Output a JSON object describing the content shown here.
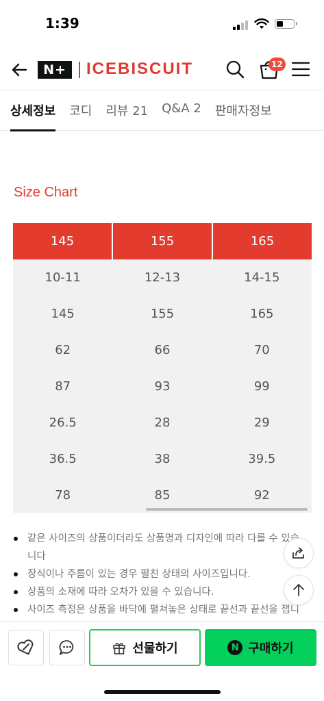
{
  "status_bar": {
    "time": "1:39"
  },
  "header": {
    "logo": "N+",
    "brand": "ICEBISCUIT",
    "cart_count": "12"
  },
  "tabs": [
    {
      "label": "상세정보",
      "active": true
    },
    {
      "label": "코디",
      "active": false
    },
    {
      "label": "리뷰 21",
      "active": false
    },
    {
      "label": "Q&A 2",
      "active": false
    },
    {
      "label": "판매자정보",
      "active": false
    }
  ],
  "size_chart": {
    "title": "Size Chart",
    "headers": [
      "145",
      "155",
      "165"
    ],
    "rows": [
      [
        "10-11",
        "12-13",
        "14-15"
      ],
      [
        "145",
        "155",
        "165"
      ],
      [
        "62",
        "66",
        "70"
      ],
      [
        "87",
        "93",
        "99"
      ],
      [
        "26.5",
        "28",
        "29"
      ],
      [
        "36.5",
        "38",
        "39.5"
      ],
      [
        "78",
        "85",
        "92"
      ]
    ]
  },
  "notes": [
    "같은 사이즈의 상품이더라도 상품명과 디자인에 따라 다를 수 있습니다",
    "장식이나 주름이 있는 경우 펼친 상태의 사이즈입니다.",
    "상품의 소재에 따라 오차가 있을 수 있습니다.",
    "사이즈 측정은 상품을 바닥에 펼쳐놓은 상태로 끝선과 끝선을 잽니"
  ],
  "bottom_bar": {
    "gift_label": "선물하기",
    "buy_label": "구매하기",
    "buy_badge": "N"
  },
  "colors": {
    "brand_red": "#e33b2e",
    "naver_green": "#03cf5d",
    "gift_border": "#2dc653"
  }
}
